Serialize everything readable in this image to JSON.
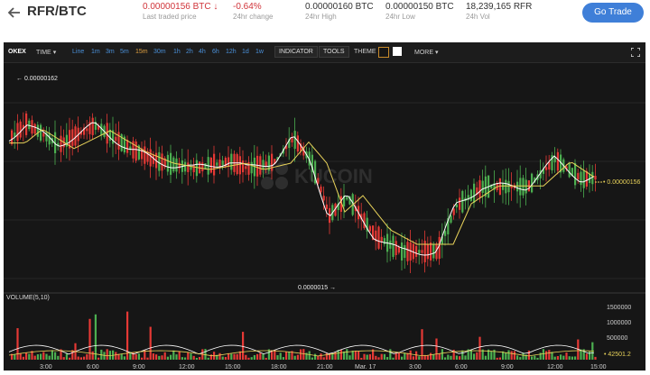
{
  "header": {
    "pair": "RFR/BTC",
    "last_price": "0.00000156 BTC",
    "last_price_label": "Last traded price",
    "change": "-0.64%",
    "change_label": "24hr change",
    "high": "0.00000160 BTC",
    "high_label": "24hr High",
    "low": "0.00000150 BTC",
    "low_label": "24hr Low",
    "vol": "18,239,165 RFR",
    "vol_label": "24h Vol",
    "go_trade": "Go Trade",
    "arrow": "↓"
  },
  "toolbar": {
    "exchange": "OKEX",
    "time_label": "TIME",
    "timeframes": [
      "Line",
      "1m",
      "3m",
      "5m",
      "15m",
      "30m",
      "1h",
      "2h",
      "4h",
      "6h",
      "12h",
      "1d",
      "1w"
    ],
    "active_timeframe": "15m",
    "indicator": "INDICATOR",
    "tools": "TOOLS",
    "theme": "THEME",
    "more": "MORE",
    "dropdown_glyph": "▾"
  },
  "chart": {
    "watermark": "KUCOIN",
    "high_marker": "0.00000162",
    "low_marker": "0.0000015",
    "last_price_tag": "0.00000156",
    "volume_label": "VOLUME(5,10)",
    "volume_ticks": [
      "1500000",
      "1000000",
      "500000"
    ],
    "last_volume": "42501.2",
    "x_labels": [
      "3:00",
      "6:00",
      "9:00",
      "12:00",
      "15:00",
      "18:00",
      "21:00",
      "Mar. 17",
      "3:00",
      "6:00",
      "9:00",
      "12:00",
      "15:00"
    ],
    "colors": {
      "up": "#4caf50",
      "down": "#e53935",
      "ma_white": "#ffffff",
      "ma_yellow": "#e8d25a",
      "bg": "#161616",
      "grid": "#2a2a2a"
    }
  },
  "chart_data": {
    "type": "candlestick",
    "interval": "15m",
    "y_range": [
      1.5e-06,
      1.62e-06
    ],
    "last_price": 1.56e-06,
    "overlays": [
      "white moving average",
      "yellow moving average"
    ],
    "volume_y_ticks": [
      500000,
      1000000,
      1500000
    ],
    "last_volume": 42501.2,
    "x_ticks": [
      "3:00",
      "6:00",
      "9:00",
      "12:00",
      "15:00",
      "18:00",
      "21:00",
      "Mar. 17",
      "3:00",
      "6:00",
      "9:00",
      "12:00",
      "15:00"
    ]
  }
}
